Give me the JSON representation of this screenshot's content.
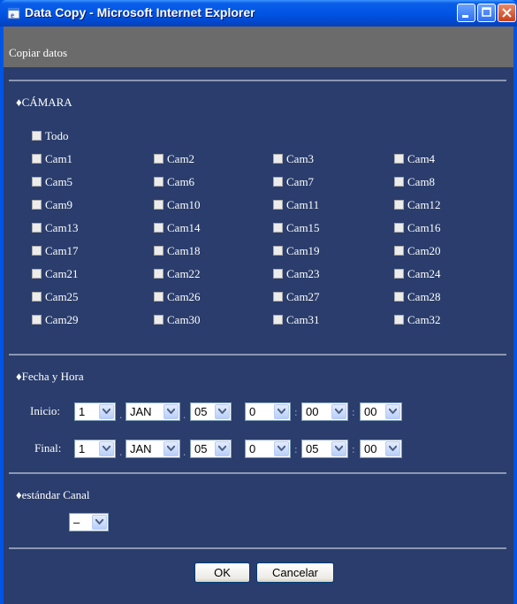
{
  "window": {
    "title": "Data Copy - Microsoft Internet Explorer"
  },
  "header": {
    "text": "Copiar datos"
  },
  "camera_section": {
    "title": "♦CÁMARA",
    "all_label": "Todo",
    "cameras": [
      "Cam1",
      "Cam2",
      "Cam3",
      "Cam4",
      "Cam5",
      "Cam6",
      "Cam7",
      "Cam8",
      "Cam9",
      "Cam10",
      "Cam11",
      "Cam12",
      "Cam13",
      "Cam14",
      "Cam15",
      "Cam16",
      "Cam17",
      "Cam18",
      "Cam19",
      "Cam20",
      "Cam21",
      "Cam22",
      "Cam23",
      "Cam24",
      "Cam25",
      "Cam26",
      "Cam27",
      "Cam28",
      "Cam29",
      "Cam30",
      "Cam31",
      "Cam32"
    ]
  },
  "datetime_section": {
    "title": "♦Fecha y Hora",
    "start": {
      "label": "Inicio:",
      "day": "1",
      "month": "JAN",
      "year": "05",
      "hour": "0",
      "minute": "00",
      "second": "00"
    },
    "end": {
      "label": "Final:",
      "day": "1",
      "month": "JAN",
      "year": "05",
      "hour": "0",
      "minute": "05",
      "second": "00"
    },
    "date_separator": ".",
    "time_separator": ":"
  },
  "channel_section": {
    "title": "♦estándar Canal",
    "value": "–"
  },
  "buttons": {
    "ok": "OK",
    "cancel": "Cancelar"
  }
}
